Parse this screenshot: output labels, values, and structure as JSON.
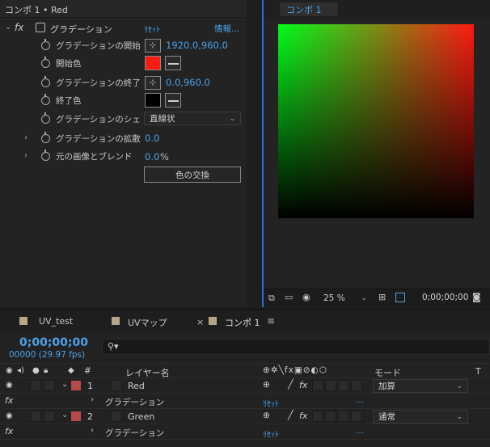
{
  "effect_controls": {
    "breadcrumb": "コンポ 1 • Red",
    "effect_name": "グラデーション",
    "reset_label": "ﾘｾｯﾄ",
    "about_label": "情報...",
    "properties": [
      {
        "label": "グラデーションの開始",
        "value": "1920.0,960.0"
      },
      {
        "label": "開始色",
        "color": "#ff1a12"
      },
      {
        "label": "グラデーションの終了",
        "value": "0.0,960.0"
      },
      {
        "label": "終了色",
        "color": "#000000"
      },
      {
        "label": "グラデーションのシェ",
        "value": "直線状"
      },
      {
        "label": "グラデーションの拡散",
        "value": "0.0"
      },
      {
        "label": "元の画像とブレンド",
        "value": "0.0",
        "unit": "%"
      }
    ],
    "swap_button": "色の交換"
  },
  "viewer": {
    "tab": "コンポ 1",
    "zoom": "25 %",
    "timecode": "0;00;00;00"
  },
  "timeline": {
    "tabs": [
      {
        "label": "UV_test"
      },
      {
        "label": "UVマップ"
      },
      {
        "label": "コンポ 1"
      }
    ],
    "close_glyph": "×",
    "menu_glyph": "≡",
    "timecode": "0;00;00;00",
    "frames": "00000 (29.97 fps)",
    "search_icon": "search-icon",
    "columns": {
      "number": "#",
      "layer_name": "レイヤー名",
      "mode": "モード",
      "track": "T"
    },
    "layers": [
      {
        "num": "1",
        "name": "Red",
        "mode": "加算",
        "label_color": "#b54a4a"
      },
      {
        "num": "2",
        "name": "Green",
        "mode": "通常",
        "label_color": "#b54a4a"
      }
    ],
    "effect_row": {
      "fx": "fx",
      "name": "グラデーション",
      "reset": "ﾘｾｯﾄ",
      "dots": "..."
    }
  },
  "colors": {
    "accent_blue": "#4aa3ea",
    "panel_bg": "#232323",
    "highlight_border": "#2d6fcf"
  }
}
